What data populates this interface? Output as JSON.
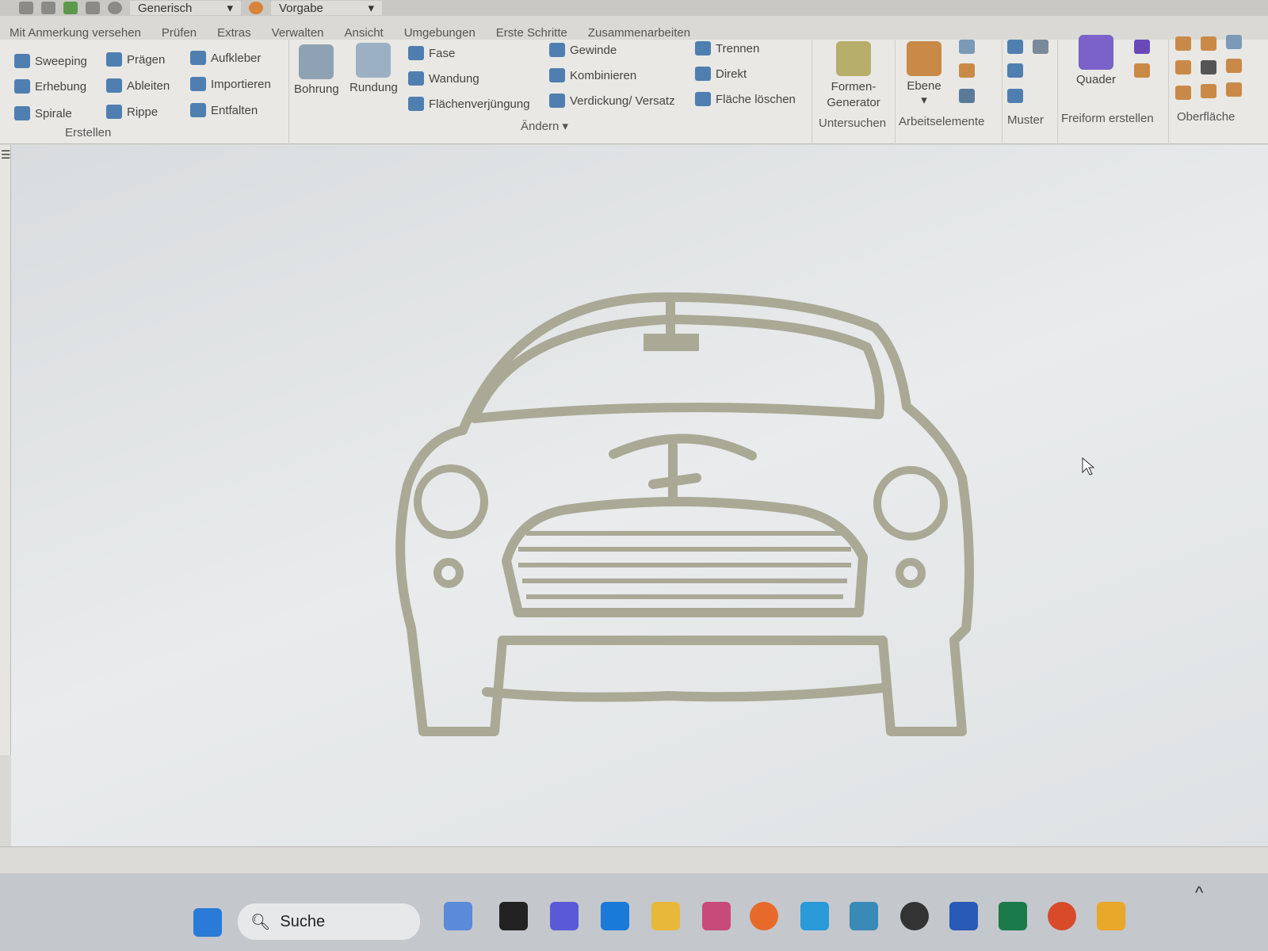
{
  "qat": {
    "material": "Generisch",
    "appearance": "Vorgabe"
  },
  "tabs": [
    "Mit Anmerkung versehen",
    "Prüfen",
    "Extras",
    "Verwalten",
    "Ansicht",
    "Umgebungen",
    "Erste Schritte",
    "Zusammenarbeiten"
  ],
  "ribbon": {
    "erstellen": {
      "label": "Erstellen",
      "items": [
        "Sweeping",
        "Prägen",
        "Aufkleber",
        "Erhebung",
        "Ableiten",
        "Importieren",
        "Spirale",
        "Rippe",
        "Entfalten"
      ]
    },
    "aendern": {
      "label": "Ändern",
      "big": [
        "Bohrung",
        "Rundung"
      ],
      "items": [
        "Fase",
        "Wandung",
        "Flächenverjüngung",
        "Gewinde",
        "Kombinieren",
        "Verdickung/ Versatz",
        "Trennen",
        "Direkt",
        "Fläche löschen"
      ]
    },
    "untersuchen": {
      "label": "Untersuchen",
      "big": "Formen-Generator"
    },
    "arbeitselemente": {
      "label": "Arbeitselemente",
      "big": "Ebene"
    },
    "muster": {
      "label": "Muster"
    },
    "freiform": {
      "label": "Freiform erstellen",
      "big": "Quader"
    },
    "oberflaeche": {
      "label": "Oberfläche"
    }
  },
  "taskbar": {
    "search": "Suche"
  },
  "colors": {
    "model": "#a9a996",
    "viewport": "#e4e6e7",
    "ribbon": "#e9e8e4"
  }
}
